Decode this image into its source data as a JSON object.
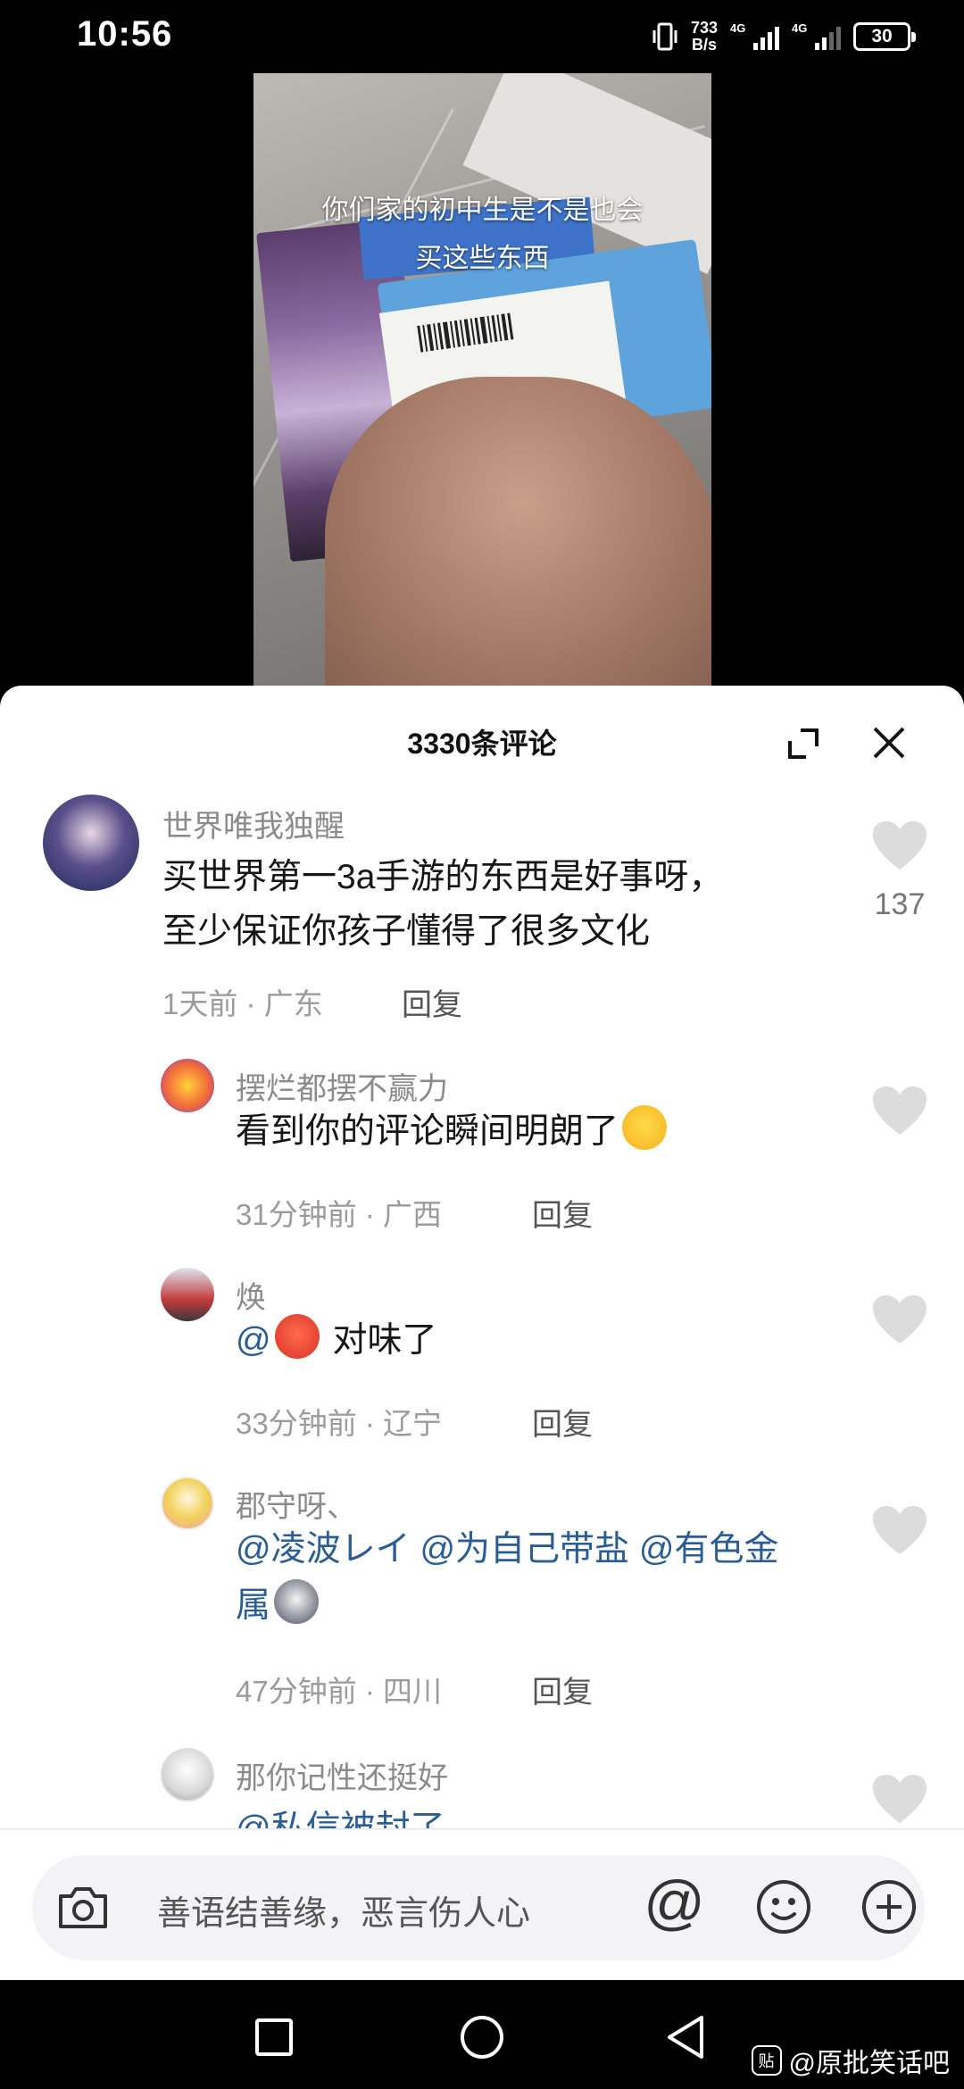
{
  "status_bar": {
    "time": "10:56",
    "net_speed_value": "733",
    "net_speed_unit": "B/s",
    "sim1_label": "4G",
    "sim2_label": "4G",
    "battery": "30"
  },
  "video": {
    "caption_line1": "你们家的初中生是不是也会",
    "caption_line2": "买这些东西"
  },
  "comments_panel": {
    "title": "3330条评论",
    "comments": [
      {
        "user": "世界唯我独醒",
        "text_line1": "买世界第一3a手游的东西是好事呀，",
        "text_line2": "至少保证你孩子懂得了很多文化",
        "time": "1天前",
        "location": "广东",
        "reply": "回复",
        "likes": "137"
      },
      {
        "user": "摆烂都摆不赢力",
        "text": "看到你的评论瞬间明朗了",
        "time": "31分钟前",
        "location": "广西",
        "reply": "回复"
      },
      {
        "user": "焕",
        "text_prefix": "@",
        "text": "对味了",
        "time": "33分钟前",
        "location": "辽宁",
        "reply": "回复"
      },
      {
        "user": "郡守呀、",
        "mention1": "@凌波レイ",
        "mention2": "@为自己带盐",
        "mention3a": "@有色金",
        "mention3b": "属",
        "time": "47分钟前",
        "location": "四川",
        "reply": "回复"
      },
      {
        "user": "那你记性还挺好",
        "text_partial": "@私信被封了"
      }
    ]
  },
  "input": {
    "placeholder": "善语结善缘，恶言伤人心",
    "at_symbol": "@"
  },
  "watermark": {
    "badge": "贴",
    "text": "@原批笑话吧"
  },
  "colors": {
    "mention": "#2a5d93",
    "meta_gray": "#9b9b9b",
    "like_gray": "#dcdcdc"
  }
}
